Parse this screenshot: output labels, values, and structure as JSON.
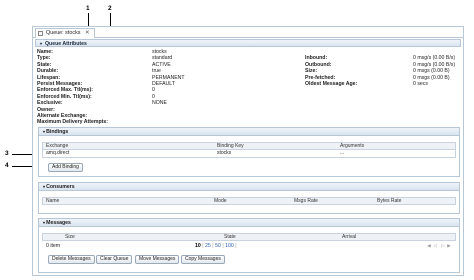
{
  "callouts": [
    "1",
    "2",
    "3",
    "4"
  ],
  "tab": {
    "label": "Queue: stocks",
    "close": "✕"
  },
  "attributes": {
    "header": "Queue Attributes",
    "left": [
      {
        "k": "Name:",
        "v": "stocks"
      },
      {
        "k": "Type:",
        "v": "standard"
      },
      {
        "k": "State:",
        "v": "ACTIVE"
      },
      {
        "k": "Durable:",
        "v": "true"
      },
      {
        "k": "Lifespan:",
        "v": "PERMANENT"
      },
      {
        "k": "Persist Messages:",
        "v": "DEFAULT"
      },
      {
        "k": "Enforced Max. Ttl(ms):",
        "v": "0"
      },
      {
        "k": "Enforced Min. Ttl(ms):",
        "v": "0"
      },
      {
        "k": "Exclusive:",
        "v": "NONE"
      },
      {
        "k": "Owner:",
        "v": ""
      },
      {
        "k": "Alternate Exchange:",
        "v": ""
      },
      {
        "k": "Maximum Delivery Attempts:",
        "v": ""
      }
    ],
    "right": [
      {
        "k": "Inbound:",
        "v": "0 msg/s (0.00 B/s)"
      },
      {
        "k": "Outbound:",
        "v": "0 msg/s (0.00 B/s)"
      },
      {
        "k": "Size:",
        "v": "0 msgs (0.00 B)"
      },
      {
        "k": "Pre-fetched:",
        "v": "0 msgs (0.00 B)"
      },
      {
        "k": "Oldest Message Age:",
        "v": "0 secs"
      }
    ]
  },
  "bindings": {
    "header": "Bindings",
    "columns": [
      "Exchange",
      "Binding Key",
      "Arguments"
    ],
    "rows": [
      [
        "amq.direct",
        "stocks",
        "..."
      ]
    ],
    "add_button": "Add Binding"
  },
  "consumers": {
    "header": "Consumers",
    "columns": [
      "Name",
      "Mode",
      "Msgs Rate",
      "Bytes Rate"
    ]
  },
  "messages": {
    "header": "Messages",
    "columns": [
      "Size",
      "State",
      "Arrival"
    ],
    "count": "0 item",
    "page_sizes": [
      "10",
      "25",
      "50",
      "100"
    ],
    "buttons": [
      "Delete Messages",
      "Clear Queue",
      "Move Messages",
      "Copy Messages"
    ]
  }
}
